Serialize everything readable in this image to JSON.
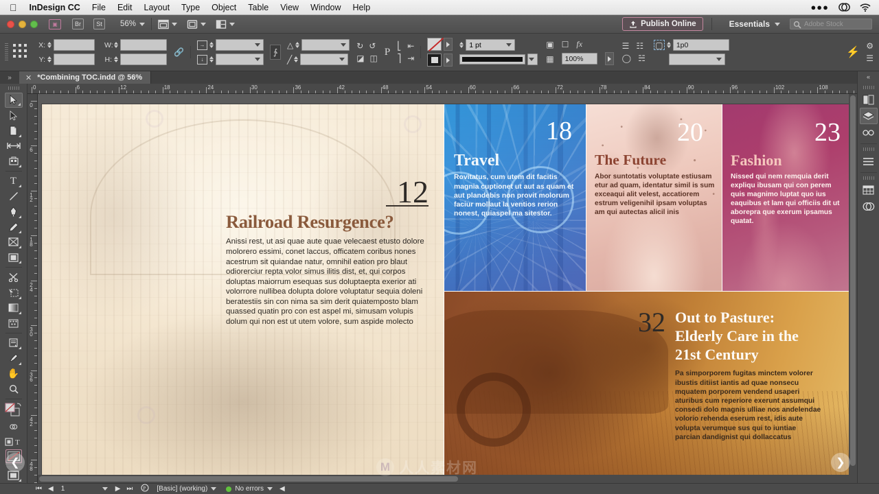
{
  "macbar": {
    "apple_icon": "apple-logo",
    "app_name": "InDesign CC",
    "menus": [
      "File",
      "Edit",
      "Layout",
      "Type",
      "Object",
      "Table",
      "View",
      "Window",
      "Help"
    ],
    "right_icons": [
      "ellipsis-icon",
      "creative-cloud-icon",
      "wifi-icon"
    ]
  },
  "appbar": {
    "bridge_label": "Br",
    "stock_label": "St",
    "zoom_level": "56%",
    "publish_label": "Publish Online",
    "workspace_label": "Essentials",
    "search_placeholder": "Adobe Stock",
    "icons": [
      "publish-upload-icon",
      "screen-mode-icon",
      "view-options-icon",
      "arrange-documents-icon"
    ]
  },
  "control_panel": {
    "x_label": "X:",
    "y_label": "Y:",
    "w_label": "W:",
    "h_label": "H:",
    "x_value": "",
    "y_value": "",
    "w_value": "",
    "h_value": "",
    "scale_x": "",
    "scale_y": "",
    "rotate_value": "",
    "shear_value": "",
    "stroke_weight": "1 pt",
    "opacity": "100%",
    "gap_value": "1p0",
    "p_label": "P",
    "icons": [
      "reference-point-icon",
      "constrain-proportions-icon",
      "rotate-cw-icon",
      "rotate-ccw-icon",
      "flip-horizontal-icon",
      "flip-vertical-icon",
      "align-left-icon",
      "align-center-icon",
      "distribute-icon",
      "fill-swatch-icon",
      "stroke-swatch-icon",
      "corner-options-icon",
      "effects-icon",
      "text-wrap-icon",
      "frame-fitting-icon",
      "preferences-gear-icon",
      "quick-apply-icon"
    ]
  },
  "tab": {
    "collapse_icon": "double-chevron-right-icon",
    "close_icon": "close-icon",
    "title": "*Combining TOC.indd @ 56%"
  },
  "tools": [
    {
      "name": "selection-tool",
      "glyph": "▶",
      "selected": true
    },
    {
      "name": "direct-selection-tool",
      "glyph": "▶",
      "selected": false
    },
    {
      "name": "page-tool",
      "glyph": "◱",
      "selected": false
    },
    {
      "name": "gap-tool",
      "glyph": "↔",
      "selected": false
    },
    {
      "name": "content-collector-tool",
      "glyph": "☷",
      "selected": false
    },
    {
      "name": "type-tool",
      "glyph": "T",
      "selected": false
    },
    {
      "name": "line-tool",
      "glyph": "╱",
      "selected": false
    },
    {
      "name": "pen-tool",
      "glyph": "✒",
      "selected": false
    },
    {
      "name": "pencil-tool",
      "glyph": "✎",
      "selected": false
    },
    {
      "name": "rectangle-frame-tool",
      "glyph": "⊠",
      "selected": false
    },
    {
      "name": "rectangle-tool",
      "glyph": "■",
      "selected": false
    },
    {
      "name": "scissors-tool",
      "glyph": "✂",
      "selected": false
    },
    {
      "name": "free-transform-tool",
      "glyph": "⬚",
      "selected": false
    },
    {
      "name": "gradient-swatch-tool",
      "glyph": "▤",
      "selected": false
    },
    {
      "name": "gradient-feather-tool",
      "glyph": "▦",
      "selected": false
    },
    {
      "name": "note-tool",
      "glyph": "☷",
      "selected": false
    },
    {
      "name": "eyedropper-tool",
      "glyph": "⚗",
      "selected": false
    },
    {
      "name": "hand-tool",
      "glyph": "✋",
      "selected": false
    },
    {
      "name": "zoom-tool",
      "glyph": "⚲",
      "selected": false
    }
  ],
  "rulers": {
    "unit": "picas",
    "horizontal_ticks": [
      0,
      6,
      12,
      18,
      24,
      30,
      36,
      42,
      48,
      54,
      60,
      66,
      72,
      78,
      84,
      90,
      96,
      102,
      108
    ],
    "vertical_ticks": [
      0,
      6,
      12,
      18,
      24,
      30,
      36,
      42,
      48
    ]
  },
  "spread": {
    "blocks": [
      {
        "id": "railroad",
        "name": "railroad-article-block",
        "page_number": "12",
        "title": "Railroad Resurgence?",
        "body": "Anissi rest, ut asi quae aute quae velecaest etusto dolore molorero essimi, conet laccus, officatem coribus nones acestrum sit quiandae natur, omnihil eation pro blaut odiorerciur repta volor simus ilitis dist, et, qui corpos doluptas maiorrum esequas sus doluptaepta exerior ati volorrore nullibea dolupta dolore voluptatur sequia doleni beratestiis sin con nima sa sim derit quiatemposto blam quassed quatin pro con est aspel mi, simusam volupis dolum qui non est ut utem volore, sum aspide molecto",
        "number_color": "#2e2a27",
        "title_color": "#8a5a3c",
        "body_color": "#2d2924"
      },
      {
        "id": "travel",
        "name": "travel-article-block",
        "page_number": "18",
        "title": "Travel",
        "body": "Rovitatus, cum utem dit facitis magnia cuptionet ut aut as quam et aut plandebis non provit molorum faciur mollaut la ventios rerion nonest, quiaspel ma sitestor.",
        "number_color": "#ffffff",
        "title_color": "#f2f8fb",
        "body_color": "#f0f6fa"
      },
      {
        "id": "future",
        "name": "future-article-block",
        "page_number": "20",
        "title": "The Future",
        "body": "Abor suntotatis voluptate estiusam etur ad quam, identatur simil is sum exceaqui alit velest, accatiorem estrum veligenihil ipsam voluptas am qui autectas alicil inis",
        "number_color": "#ffffff",
        "title_color": "#8c4432",
        "body_color": "#5b3326"
      },
      {
        "id": "fashion",
        "name": "fashion-article-block",
        "page_number": "23",
        "title": "Fashion",
        "body": "Nissed qui nem remquia derit expliqu ibusam qui con perem quis magnimo luptat quo ius eaquibus et lam qui officiis dit ut aborepra que exerum ipsamus quatat.",
        "number_color": "#ffffff",
        "title_color": "#f5c7bd",
        "body_color": "#fdf2ee"
      },
      {
        "id": "pasture",
        "name": "pasture-article-block",
        "page_number": "32",
        "title": "Out to Pasture: Elderly Care in the 21st Century",
        "body": "Pa simporporem fugitas minctem volorer ibustis ditiist iantis ad quae nonsecu mquatem porporem vendend usaperi aturibus cum reperiore exerunt assumqui consedi dolo magnis ulliae nos andelendae volorio rehenda eserum rest, idis aute volupta verumque sus qui to iuntiae parcian dandignist qui dollaccatus",
        "number_color": "#2e2a27",
        "title_color": "#fdfaf5",
        "body_color": "#3a2a1c"
      }
    ]
  },
  "right_dock": {
    "collapse_icon": "double-chevron-left-icon",
    "items": [
      {
        "name": "pages-panel-icon",
        "glyph": "◧",
        "selected": false
      },
      {
        "name": "layers-panel-icon",
        "glyph": "◆",
        "selected": true
      },
      {
        "name": "links-panel-icon",
        "glyph": "⚭",
        "selected": false
      },
      {
        "name": "paragraph-styles-panel-icon",
        "glyph": "☰",
        "selected": false
      },
      {
        "name": "table-panel-icon",
        "glyph": "▦",
        "selected": false
      },
      {
        "name": "cc-libraries-panel-icon",
        "glyph": "∞",
        "selected": false
      }
    ]
  },
  "status_bar": {
    "page_number": "1",
    "first_icon": "first-page-icon",
    "prev_icon": "previous-page-icon",
    "next_icon": "next-page-icon",
    "last_icon": "last-page-icon",
    "master_icon": "page-master-icon",
    "master_label": "[Basic] (working)",
    "preflight_status": "No errors",
    "preflight_color": "#61c23d"
  },
  "watermark": {
    "logo_letter": "M",
    "text": "人人素材网",
    "corner_text": "素"
  }
}
